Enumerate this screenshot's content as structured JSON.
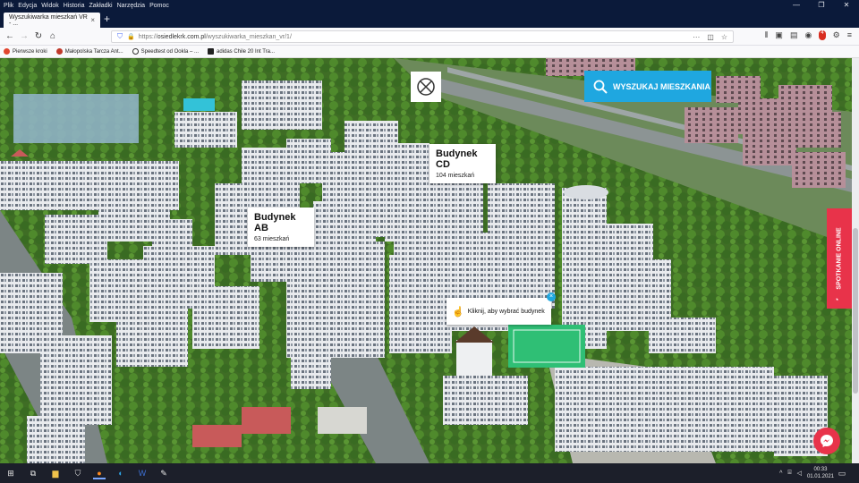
{
  "menubar": {
    "items": [
      "Plik",
      "Edycja",
      "Widok",
      "Historia",
      "Zakładki",
      "Narzędzia",
      "Pomoc"
    ]
  },
  "tab": {
    "title": "Wyszukiwarka mieszkań VR - ..."
  },
  "url": {
    "scheme": "https://",
    "host": "osiedlekrk.com.pl",
    "path": "/wyszukiwarka_mieszkan_vr/1/"
  },
  "bookmarks": [
    {
      "label": "Pierwsze kroki",
      "color": "#e1462f"
    },
    {
      "label": "Małopolska Tarcza Ant...",
      "color": "#c0392b"
    },
    {
      "label": "Speedtest od Ookla – ...",
      "color": "#333333"
    },
    {
      "label": "adidas Chile 20 Int Tra...",
      "color": "#222222"
    }
  ],
  "buildings": [
    {
      "title": "Budynek CD",
      "sub": "104 mieszkań"
    },
    {
      "title": "Budynek AB",
      "sub": "63 mieszkań"
    }
  ],
  "search_button": "WYSZUKAJ MIESZKANIA",
  "hint": "Kliknij, aby wybrać budynek",
  "online": "SPOTKANIE ONLINE",
  "browser_badge": "4",
  "clock": {
    "time": "00:33",
    "date": "01.01.2021"
  },
  "colors": {
    "accent": "#1fa7e0",
    "online": "#e8334a",
    "titlebar": "#0b1a3a"
  }
}
